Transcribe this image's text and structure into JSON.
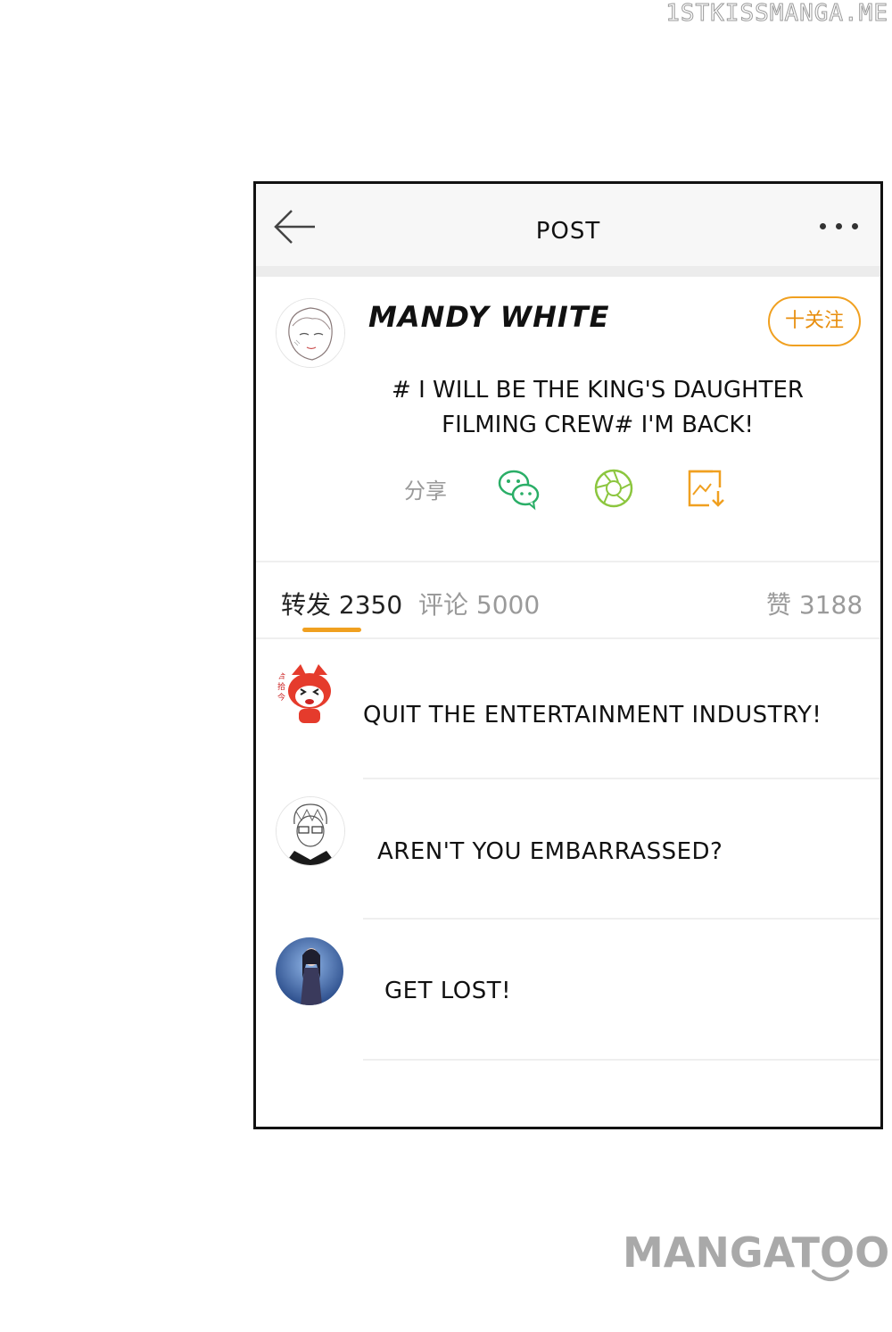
{
  "watermark": "1STKISSMANGA.ME",
  "header": {
    "title": "POST",
    "back_icon": "arrow-left-icon",
    "more_icon": "more-dots-icon"
  },
  "post": {
    "author": "MANDY WHITE",
    "follow_label": "十关注",
    "text_line1": "# I WILL BE THE KING'S DAUGHTER",
    "text_line2": "FILMING CREW# I'M BACK!",
    "share_label": "分享",
    "share_icons": [
      "wechat-icon",
      "moments-icon",
      "save-image-icon"
    ]
  },
  "stats": {
    "repost": "转发 2350",
    "comments": "评论 5000",
    "likes": "赞 3188"
  },
  "comments": [
    {
      "text": "QUIT THE ENTERTAINMENT INDUSTRY!",
      "avatar": "red-panda-avatar"
    },
    {
      "text": "AREN'T YOU EMBARRASSED?",
      "avatar": "glasses-boy-avatar"
    },
    {
      "text": "GET LOST!",
      "avatar": "woman-blue-avatar"
    }
  ],
  "brand": "MANGATOON",
  "colors": {
    "accent": "#f0a020",
    "wechat": "#2aae67",
    "moments": "#8cc63f"
  }
}
